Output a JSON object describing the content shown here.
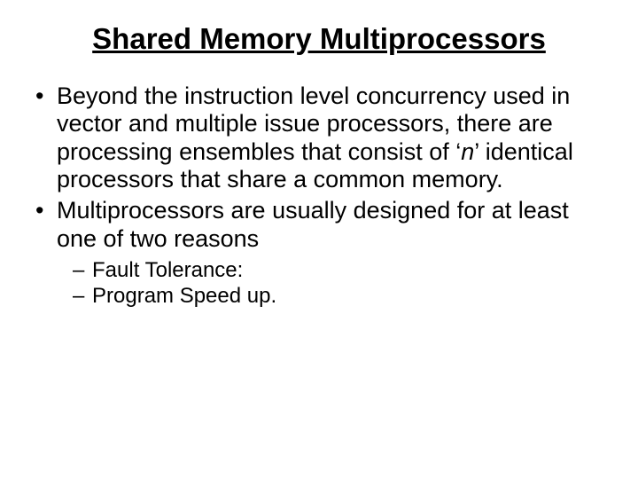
{
  "title": "Shared Memory Multiprocessors",
  "bullets": [
    {
      "pre": "Beyond the instruction level concurrency used in vector and multiple issue processors, there are processing ensembles that consist of ‘",
      "em": "n",
      "post": "’ identical processors that share a common memory."
    },
    {
      "text": "Multiprocessors are usually designed for at least one of two reasons",
      "sub": [
        "Fault Tolerance:",
        "Program Speed up."
      ]
    }
  ]
}
